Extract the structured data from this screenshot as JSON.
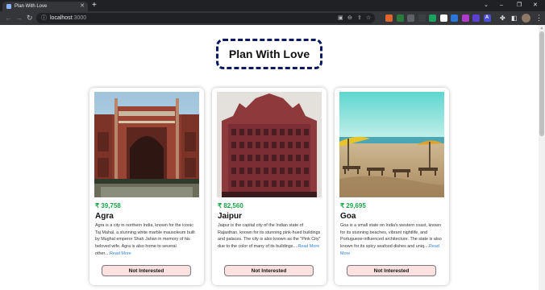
{
  "browser": {
    "tab_title": "Plan With Love",
    "tab_close": "✕",
    "new_tab": "+",
    "url_host": "localhost",
    "url_port": ":3000",
    "window_controls": {
      "collapse": "⌄",
      "minimize": "–",
      "maximize": "❐",
      "close": "✕"
    },
    "nav": {
      "back": "←",
      "forward": "→",
      "reload": "↻",
      "info": "ⓘ"
    },
    "omnibox_icons": {
      "qr": "▣",
      "zoom": "⊖",
      "share": "⇪",
      "bookmark": "☆"
    },
    "extensions": [
      {
        "name": "ext-1-icon",
        "color": "#e0662c",
        "text": ""
      },
      {
        "name": "ext-2-icon",
        "color": "#2a7a3b",
        "text": ""
      },
      {
        "name": "ext-3-icon",
        "color": "#5f6368",
        "text": ""
      },
      {
        "name": "ext-4-icon",
        "color": "#3c4043",
        "text": ""
      },
      {
        "name": "ext-5-icon",
        "color": "#1aa260",
        "text": ""
      },
      {
        "name": "ext-6-icon",
        "color": "#ffffff",
        "text": ""
      },
      {
        "name": "ext-7-icon",
        "color": "#2b77d9",
        "text": ""
      },
      {
        "name": "ext-8-icon",
        "color": "#b03acb",
        "text": ""
      },
      {
        "name": "ext-9-icon",
        "color": "#5b3fd4",
        "text": ""
      },
      {
        "name": "ext-10-icon",
        "color": "#4c4fd8",
        "text": "A"
      }
    ],
    "toolbar_icons": {
      "puzzle": "✤",
      "sidepanel": "◧",
      "kebab": "⋮"
    },
    "scroll_up": "▲"
  },
  "page": {
    "heading": "Plan With Love",
    "tours": [
      {
        "price": "₹ 39,758",
        "city": "Agra",
        "description": "Agra is a city in northern India, known for the iconic Taj Mahal, a stunning white marble mausoleum built by Mughal emperor Shah Jahan in memory of his beloved wife. Agra is also home to several other....",
        "read_more": "Read More",
        "button": "Not Interested"
      },
      {
        "price": "₹ 82,560",
        "city": "Jaipur",
        "description": "Jaipur is the capital city of the Indian state of Rajasthan, known for its stunning pink-hued buildings and palaces. The city is also known as the \"Pink City\" due to the color of many of its buildings....",
        "read_more": "Read More",
        "button": "Not Interested"
      },
      {
        "price": "₹ 29,695",
        "city": "Goa",
        "description": "Goa is a small state on India's western coast, known for its stunning beaches, vibrant nightlife, and Portuguese-influenced architecture. The state is also known for its spicy seafood dishes and uniq....",
        "read_more": "Read More",
        "button": "Not Interested"
      }
    ]
  },
  "colors": {
    "price": "#1fa34a",
    "read_more": "#2f7fd6",
    "button_bg": "#fde0e0",
    "heading_border": "#0b1a5e"
  }
}
